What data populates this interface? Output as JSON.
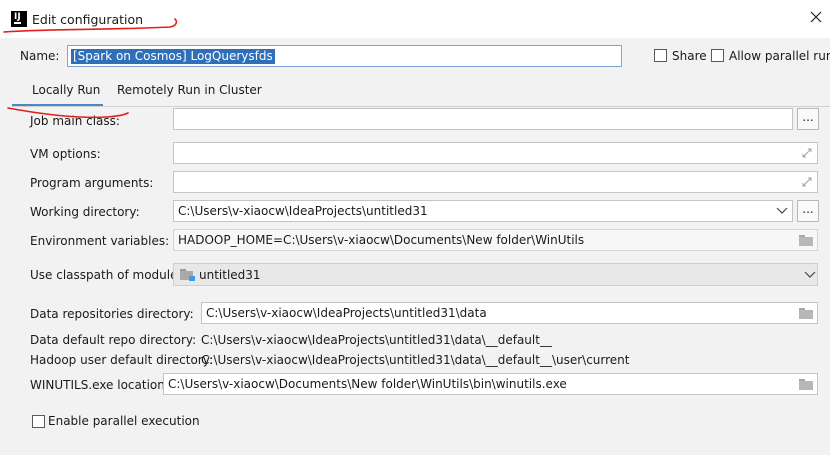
{
  "window": {
    "title": "Edit configuration"
  },
  "name": {
    "label": "Name:",
    "value": "[Spark on Cosmos] LogQuerysfds"
  },
  "options": {
    "share_label": "Share",
    "parallel_run_label": "Allow parallel run"
  },
  "tabs": [
    {
      "label": "Locally Run",
      "active": true
    },
    {
      "label": "Remotely Run in Cluster",
      "active": false
    }
  ],
  "fields": {
    "job_main_class": {
      "label": "Job main class:",
      "value": ""
    },
    "vm_options": {
      "label": "VM options:",
      "value": ""
    },
    "program_arguments": {
      "label": "Program arguments:",
      "value": ""
    },
    "working_directory": {
      "label": "Working directory:",
      "value": "C:\\Users\\v-xiaocw\\IdeaProjects\\untitled31"
    },
    "environment_variables": {
      "label": "Environment variables:",
      "value": "HADOOP_HOME=C:\\Users\\v-xiaocw\\Documents\\New folder\\WinUtils"
    },
    "classpath_module": {
      "label": "Use classpath of module:",
      "value": "untitled31"
    },
    "data_repositories_directory": {
      "label": "Data repositories directory:",
      "value": "C:\\Users\\v-xiaocw\\IdeaProjects\\untitled31\\data"
    },
    "data_default_repo_directory": {
      "label": "Data default repo directory:",
      "value": "C:\\Users\\v-xiaocw\\IdeaProjects\\untitled31\\data\\__default__"
    },
    "hadoop_user_default_directory": {
      "label": "Hadoop user default directory:",
      "value": "C:\\Users\\v-xiaocw\\IdeaProjects\\untitled31\\data\\__default__\\user\\current"
    },
    "winutils_location": {
      "label": "WINUTILS.exe location:",
      "value": "C:\\Users\\v-xiaocw\\Documents\\New folder\\WinUtils\\bin\\winutils.exe"
    }
  },
  "enable_parallel_execution": {
    "label": "Enable parallel execution",
    "checked": false
  },
  "browse_label": "...",
  "icons": {
    "app": "intellij-icon",
    "close": "close-icon",
    "expand": "expand-icon",
    "folder": "folder-icon",
    "dropdown": "chevron-down-icon",
    "module": "module-icon"
  },
  "colors": {
    "accent": "#4a88c7",
    "selection": "#2e6fb8",
    "annotation": "#e0201b"
  }
}
